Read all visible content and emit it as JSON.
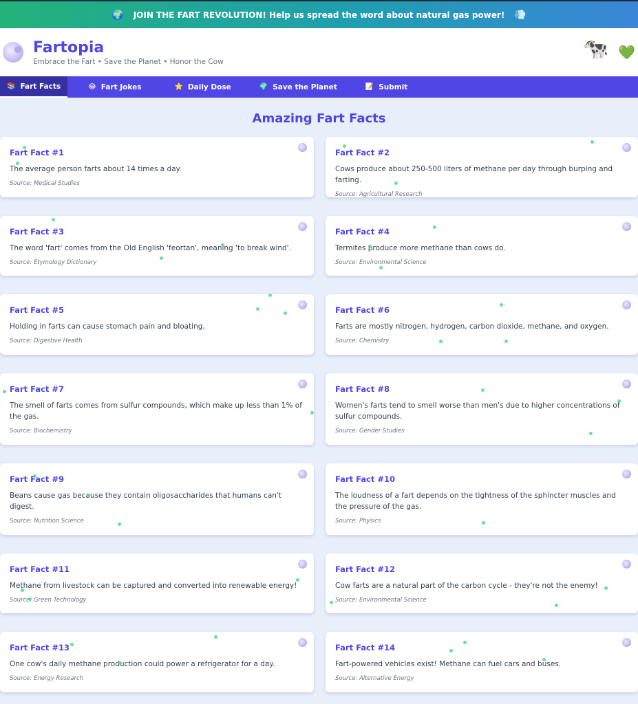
{
  "banner": {
    "left_emoji": "🌍",
    "text": "JOIN THE FART REVOLUTION! Help us spread the word about natural gas power!",
    "right_emoji": "💨"
  },
  "header": {
    "title": "Fartopia",
    "subtitle": "Embrace the Fart • Save the Planet • Honor the Cow",
    "cow_emoji": "🐄",
    "heart_emoji": "💚"
  },
  "nav": {
    "items": [
      {
        "icon": "📚",
        "label": "Fart Facts"
      },
      {
        "icon": "😂",
        "label": "Fart Jokes"
      },
      {
        "icon": "⭐",
        "label": "Daily Dose"
      },
      {
        "icon": "🌍",
        "label": "Save the Planet"
      },
      {
        "icon": "📝",
        "label": "Submit"
      }
    ]
  },
  "main": {
    "heading": "Amazing Fart Facts",
    "facts": [
      {
        "title": "Fart Fact #1",
        "text": "The average person farts about 14 times a day.",
        "source": "Source: Medical Studies"
      },
      {
        "title": "Fart Fact #2",
        "text": "Cows produce about 250-500 liters of methane per day through burping and farting.",
        "source": "Source: Agricultural Research"
      },
      {
        "title": "Fart Fact #3",
        "text": "The word 'fart' comes from the Old English 'feortan', meaning 'to break wind'.",
        "source": "Source: Etymology Dictionary"
      },
      {
        "title": "Fart Fact #4",
        "text": "Termites produce more methane than cows do.",
        "source": "Source: Environmental Science"
      },
      {
        "title": "Fart Fact #5",
        "text": "Holding in farts can cause stomach pain and bloating.",
        "source": "Source: Digestive Health"
      },
      {
        "title": "Fart Fact #6",
        "text": "Farts are mostly nitrogen, hydrogen, carbon dioxide, methane, and oxygen.",
        "source": "Source: Chemistry"
      },
      {
        "title": "Fart Fact #7",
        "text": "The smell of farts comes from sulfur compounds, which make up less than 1% of the gas.",
        "source": "Source: Biochemistry"
      },
      {
        "title": "Fart Fact #8",
        "text": "Women's farts tend to smell worse than men's due to higher concentrations of sulfur compounds.",
        "source": "Source: Gender Studies"
      },
      {
        "title": "Fart Fact #9",
        "text": "Beans cause gas because they contain oligosaccharides that humans can't digest.",
        "source": "Source: Nutrition Science"
      },
      {
        "title": "Fart Fact #10",
        "text": "The loudness of a fart depends on the tightness of the sphincter muscles and the pressure of the gas.",
        "source": "Source: Physics"
      },
      {
        "title": "Fart Fact #11",
        "text": "Methane from livestock can be captured and converted into renewable energy!",
        "source": "Source: Green Technology"
      },
      {
        "title": "Fart Fact #12",
        "text": "Cow farts are a natural part of the carbon cycle - they're not the enemy!",
        "source": "Source: Environmental Science"
      },
      {
        "title": "Fart Fact #13",
        "text": "One cow's daily methane production could power a refrigerator for a day.",
        "source": "Source: Energy Research"
      },
      {
        "title": "Fart Fact #14",
        "text": "Fart-powered vehicles exist! Methane can fuel cars and buses.",
        "source": "Source: Alternative Energy"
      }
    ]
  },
  "colors": {
    "primary": "#4f46e5",
    "nav_active": "#3730a3",
    "banner_start": "#22b37a",
    "banner_end": "#3a86d8",
    "bubble": "#4ade80",
    "page_bg": "#e9eefb"
  }
}
